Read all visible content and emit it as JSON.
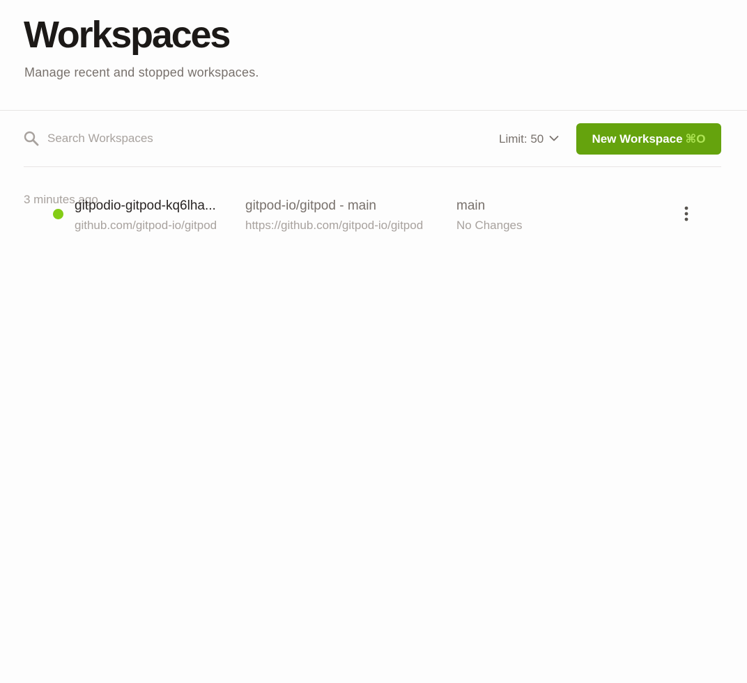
{
  "header": {
    "title": "Workspaces",
    "subtitle": "Manage recent and stopped workspaces."
  },
  "toolbar": {
    "search_placeholder": "Search Workspaces",
    "search_value": "",
    "limit_label": "Limit: 50",
    "new_workspace_label": "New Workspace",
    "new_workspace_shortcut": "⌘O"
  },
  "workspaces": [
    {
      "status": "running",
      "status_color": "#84cc16",
      "id": "gitpodio-gitpod-kq6lha...",
      "repo": "github.com/gitpod-io/gitpod",
      "context": "gitpod-io/gitpod - main",
      "context_url": "https://github.com/gitpod-io/gitpod",
      "branch": "main",
      "changes": "No Changes",
      "last_active": "3 minutes ago"
    }
  ],
  "colors": {
    "accent": "#65a30d",
    "status_running": "#84cc16"
  },
  "icons": {
    "search": "search-icon",
    "limit_chevron": "chevron-down-icon",
    "row_menu": "more-vertical-icon"
  }
}
